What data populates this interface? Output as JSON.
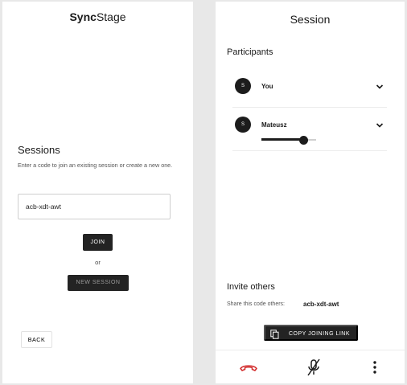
{
  "left": {
    "app_title_bold": "Sync",
    "app_title_rest": "Stage",
    "sessions_title": "Sessions",
    "sessions_desc": "Enter a code to join an existing session or create a new one.",
    "code_value": "acb-xdt-awt",
    "join_label": "JOIN",
    "or_label": "or",
    "new_session_label": "NEW SESSION",
    "back_label": "BACK"
  },
  "right": {
    "title": "Session",
    "participants_title": "Participants",
    "participants": [
      {
        "initial": "S",
        "name": "You"
      },
      {
        "initial": "S",
        "name": "Mateusz",
        "volume": 0.76
      }
    ],
    "invite_title": "Invite others",
    "invite_label": "Share this code others:",
    "invite_code": "acb-xdt-awt",
    "copy_label": "COPY JOINING LINK"
  },
  "bottom_bar": {
    "icons": [
      "hang-up-icon",
      "mic-off-icon",
      "more-vert-icon"
    ],
    "hangup_color": "#d32f2f"
  },
  "colors": {
    "button_dark": "#232323",
    "avatar": "#1c1c1c"
  }
}
